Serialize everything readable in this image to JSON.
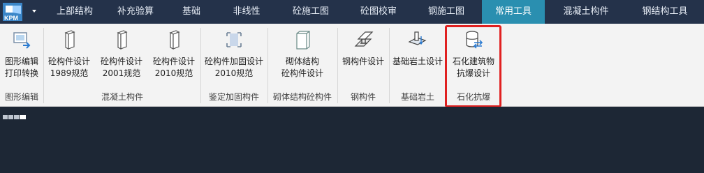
{
  "app": {
    "logo_text": "KPM"
  },
  "menu": [
    {
      "label": "上部结构"
    },
    {
      "label": "补充验算"
    },
    {
      "label": "基础"
    },
    {
      "label": "非线性"
    },
    {
      "label": "砼施工图"
    },
    {
      "label": "砼图校审"
    },
    {
      "label": "钢施工图"
    },
    {
      "label": "常用工具",
      "active": true
    },
    {
      "label": "混凝土构件"
    },
    {
      "label": "钢结构工具"
    }
  ],
  "ribbon": {
    "buttons": [
      {
        "line1": "图形编辑",
        "line2": "打印转换",
        "icon": "graphic-edit-icon"
      },
      {
        "line1": "砼构件设计",
        "line2": "1989规范",
        "icon": "concrete-column-icon"
      },
      {
        "line1": "砼构件设计",
        "line2": "2001规范",
        "icon": "concrete-column-icon"
      },
      {
        "line1": "砼构件设计",
        "line2": "2010规范",
        "icon": "concrete-column-icon"
      },
      {
        "line1": "砼构件加固设计",
        "line2": "2010规范",
        "icon": "reinforcement-icon"
      },
      {
        "line1": "砌体结构",
        "line2": "砼构件设计",
        "icon": "masonry-icon"
      },
      {
        "line1": "钢构件设计",
        "line2": "",
        "icon": "steel-beam-icon"
      },
      {
        "line1": "基础岩土设计",
        "line2": "",
        "icon": "foundation-icon"
      },
      {
        "line1": "石化建筑物",
        "line2": "抗爆设计",
        "icon": "database-exchange-icon"
      }
    ],
    "groups": [
      {
        "label": "图形编辑"
      },
      {
        "label": "混凝土构件"
      },
      {
        "label": "鉴定加固构件"
      },
      {
        "label": "砌体结构砼构件"
      },
      {
        "label": "钢构件"
      },
      {
        "label": "基础岩土"
      },
      {
        "label": "石化抗爆"
      }
    ]
  }
}
